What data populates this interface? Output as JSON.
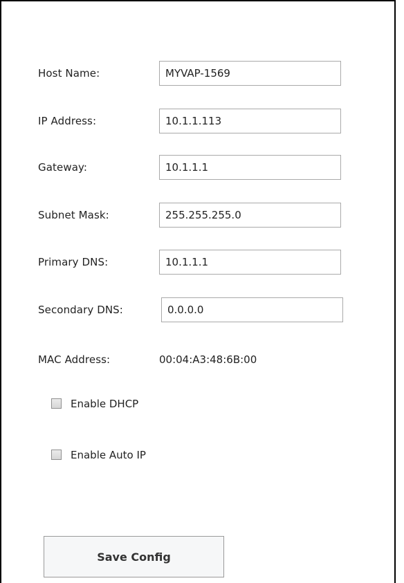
{
  "form": {
    "host_name": {
      "label": "Host Name:",
      "value": "MYVAP-1569"
    },
    "ip_address": {
      "label": "IP Address:",
      "value": "10.1.1.113"
    },
    "gateway": {
      "label": "Gateway:",
      "value": "10.1.1.1"
    },
    "subnet_mask": {
      "label": "Subnet Mask:",
      "value": "255.255.255.0"
    },
    "primary_dns": {
      "label": "Primary DNS:",
      "value": "10.1.1.1"
    },
    "secondary_dns": {
      "label": "Secondary DNS:",
      "value": "0.0.0.0"
    },
    "mac_address": {
      "label": "MAC Address:",
      "value": "00:04:A3:48:6B:00"
    },
    "enable_dhcp": {
      "label": "Enable DHCP",
      "checked": false
    },
    "enable_auto_ip": {
      "label": "Enable Auto IP",
      "checked": false
    },
    "save_label": "Save Config"
  }
}
